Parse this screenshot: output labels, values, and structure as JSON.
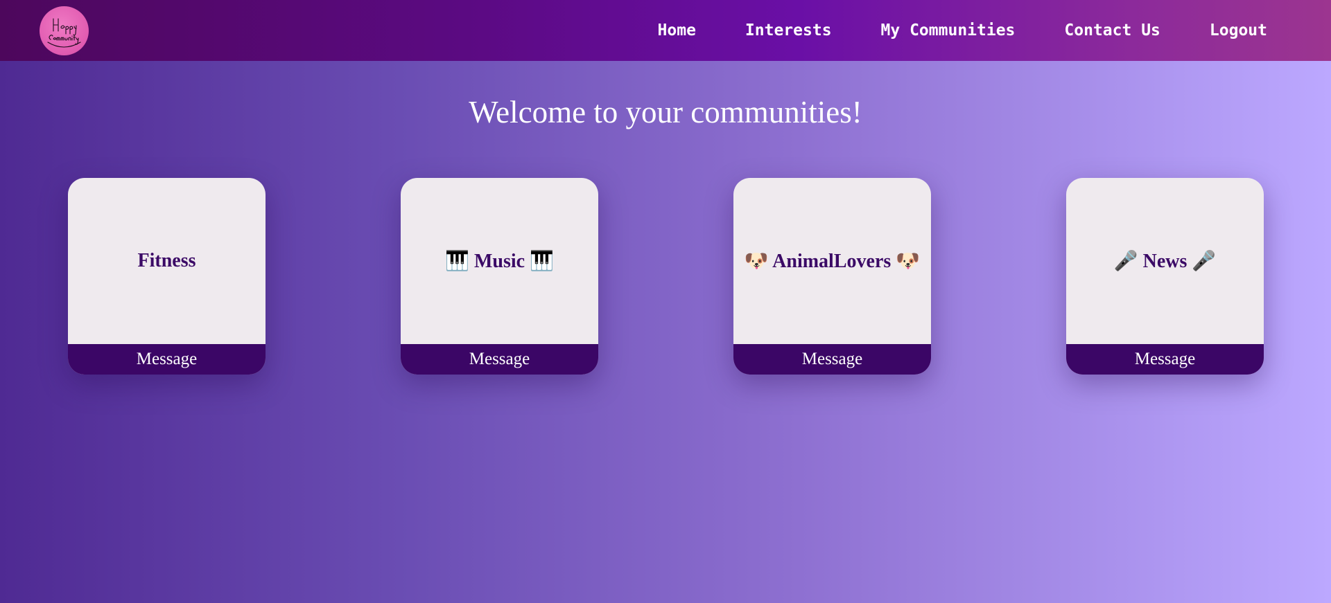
{
  "logo": {
    "label": "Happy Community",
    "line1": "Happy",
    "line2": "Community"
  },
  "nav": {
    "items": [
      {
        "label": "Home"
      },
      {
        "label": "Interests"
      },
      {
        "label": "My Communities"
      },
      {
        "label": "Contact Us"
      },
      {
        "label": "Logout"
      }
    ]
  },
  "main": {
    "title": "Welcome to your communities!"
  },
  "communities": [
    {
      "title": "Fitness",
      "action": "Message"
    },
    {
      "title": "🎹 Music 🎹",
      "action": "Message"
    },
    {
      "title": "🐶 AnimalLovers 🐶",
      "action": "Message"
    },
    {
      "title": "🎤 News 🎤",
      "action": "Message"
    }
  ],
  "colors": {
    "navbar": "#5b0a82",
    "card_bg": "#efeaee",
    "card_title": "#3b0a66",
    "message_bar": "#3b0666",
    "logo": "#e05ab0"
  }
}
